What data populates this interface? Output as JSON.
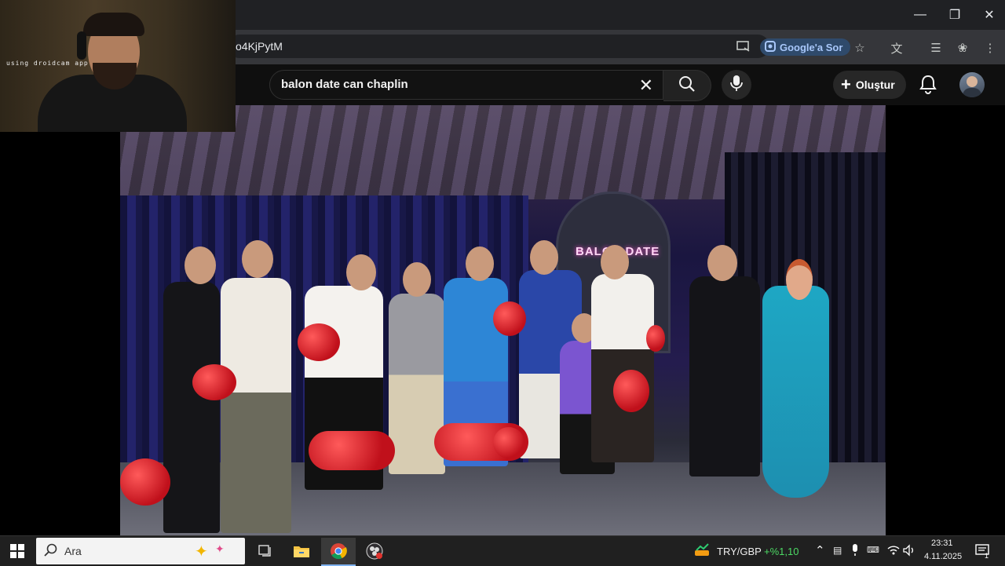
{
  "browser": {
    "url_fragment": "o4KjPytM",
    "ask_google_label": "Google'a Sor"
  },
  "youtube": {
    "search_query": "balon date can chaplin",
    "create_label": "Oluştur"
  },
  "video": {
    "sign_text": "BALON DATE"
  },
  "webcam": {
    "label": "using droidcam app"
  },
  "taskbar": {
    "search_placeholder": "Ara",
    "ticker_symbol": "TRY/GBP",
    "ticker_change": "+%1,10",
    "time": "23:31",
    "date": "4.11.2025",
    "notification_count": "1"
  }
}
